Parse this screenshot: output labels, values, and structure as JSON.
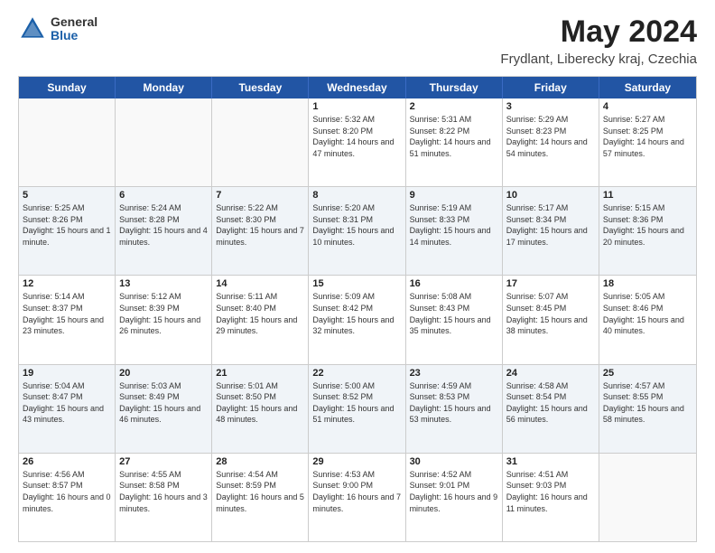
{
  "logo": {
    "general": "General",
    "blue": "Blue"
  },
  "header": {
    "title": "May 2024",
    "subtitle": "Frydlant, Liberecky kraj, Czechia"
  },
  "days": [
    "Sunday",
    "Monday",
    "Tuesday",
    "Wednesday",
    "Thursday",
    "Friday",
    "Saturday"
  ],
  "weeks": [
    [
      {
        "date": "",
        "sunrise": "",
        "sunset": "",
        "daylight": "",
        "empty": true
      },
      {
        "date": "",
        "sunrise": "",
        "sunset": "",
        "daylight": "",
        "empty": true
      },
      {
        "date": "",
        "sunrise": "",
        "sunset": "",
        "daylight": "",
        "empty": true
      },
      {
        "date": "1",
        "sunrise": "Sunrise: 5:32 AM",
        "sunset": "Sunset: 8:20 PM",
        "daylight": "Daylight: 14 hours and 47 minutes."
      },
      {
        "date": "2",
        "sunrise": "Sunrise: 5:31 AM",
        "sunset": "Sunset: 8:22 PM",
        "daylight": "Daylight: 14 hours and 51 minutes."
      },
      {
        "date": "3",
        "sunrise": "Sunrise: 5:29 AM",
        "sunset": "Sunset: 8:23 PM",
        "daylight": "Daylight: 14 hours and 54 minutes."
      },
      {
        "date": "4",
        "sunrise": "Sunrise: 5:27 AM",
        "sunset": "Sunset: 8:25 PM",
        "daylight": "Daylight: 14 hours and 57 minutes."
      }
    ],
    [
      {
        "date": "5",
        "sunrise": "Sunrise: 5:25 AM",
        "sunset": "Sunset: 8:26 PM",
        "daylight": "Daylight: 15 hours and 1 minute."
      },
      {
        "date": "6",
        "sunrise": "Sunrise: 5:24 AM",
        "sunset": "Sunset: 8:28 PM",
        "daylight": "Daylight: 15 hours and 4 minutes."
      },
      {
        "date": "7",
        "sunrise": "Sunrise: 5:22 AM",
        "sunset": "Sunset: 8:30 PM",
        "daylight": "Daylight: 15 hours and 7 minutes."
      },
      {
        "date": "8",
        "sunrise": "Sunrise: 5:20 AM",
        "sunset": "Sunset: 8:31 PM",
        "daylight": "Daylight: 15 hours and 10 minutes."
      },
      {
        "date": "9",
        "sunrise": "Sunrise: 5:19 AM",
        "sunset": "Sunset: 8:33 PM",
        "daylight": "Daylight: 15 hours and 14 minutes."
      },
      {
        "date": "10",
        "sunrise": "Sunrise: 5:17 AM",
        "sunset": "Sunset: 8:34 PM",
        "daylight": "Daylight: 15 hours and 17 minutes."
      },
      {
        "date": "11",
        "sunrise": "Sunrise: 5:15 AM",
        "sunset": "Sunset: 8:36 PM",
        "daylight": "Daylight: 15 hours and 20 minutes."
      }
    ],
    [
      {
        "date": "12",
        "sunrise": "Sunrise: 5:14 AM",
        "sunset": "Sunset: 8:37 PM",
        "daylight": "Daylight: 15 hours and 23 minutes."
      },
      {
        "date": "13",
        "sunrise": "Sunrise: 5:12 AM",
        "sunset": "Sunset: 8:39 PM",
        "daylight": "Daylight: 15 hours and 26 minutes."
      },
      {
        "date": "14",
        "sunrise": "Sunrise: 5:11 AM",
        "sunset": "Sunset: 8:40 PM",
        "daylight": "Daylight: 15 hours and 29 minutes."
      },
      {
        "date": "15",
        "sunrise": "Sunrise: 5:09 AM",
        "sunset": "Sunset: 8:42 PM",
        "daylight": "Daylight: 15 hours and 32 minutes."
      },
      {
        "date": "16",
        "sunrise": "Sunrise: 5:08 AM",
        "sunset": "Sunset: 8:43 PM",
        "daylight": "Daylight: 15 hours and 35 minutes."
      },
      {
        "date": "17",
        "sunrise": "Sunrise: 5:07 AM",
        "sunset": "Sunset: 8:45 PM",
        "daylight": "Daylight: 15 hours and 38 minutes."
      },
      {
        "date": "18",
        "sunrise": "Sunrise: 5:05 AM",
        "sunset": "Sunset: 8:46 PM",
        "daylight": "Daylight: 15 hours and 40 minutes."
      }
    ],
    [
      {
        "date": "19",
        "sunrise": "Sunrise: 5:04 AM",
        "sunset": "Sunset: 8:47 PM",
        "daylight": "Daylight: 15 hours and 43 minutes."
      },
      {
        "date": "20",
        "sunrise": "Sunrise: 5:03 AM",
        "sunset": "Sunset: 8:49 PM",
        "daylight": "Daylight: 15 hours and 46 minutes."
      },
      {
        "date": "21",
        "sunrise": "Sunrise: 5:01 AM",
        "sunset": "Sunset: 8:50 PM",
        "daylight": "Daylight: 15 hours and 48 minutes."
      },
      {
        "date": "22",
        "sunrise": "Sunrise: 5:00 AM",
        "sunset": "Sunset: 8:52 PM",
        "daylight": "Daylight: 15 hours and 51 minutes."
      },
      {
        "date": "23",
        "sunrise": "Sunrise: 4:59 AM",
        "sunset": "Sunset: 8:53 PM",
        "daylight": "Daylight: 15 hours and 53 minutes."
      },
      {
        "date": "24",
        "sunrise": "Sunrise: 4:58 AM",
        "sunset": "Sunset: 8:54 PM",
        "daylight": "Daylight: 15 hours and 56 minutes."
      },
      {
        "date": "25",
        "sunrise": "Sunrise: 4:57 AM",
        "sunset": "Sunset: 8:55 PM",
        "daylight": "Daylight: 15 hours and 58 minutes."
      }
    ],
    [
      {
        "date": "26",
        "sunrise": "Sunrise: 4:56 AM",
        "sunset": "Sunset: 8:57 PM",
        "daylight": "Daylight: 16 hours and 0 minutes."
      },
      {
        "date": "27",
        "sunrise": "Sunrise: 4:55 AM",
        "sunset": "Sunset: 8:58 PM",
        "daylight": "Daylight: 16 hours and 3 minutes."
      },
      {
        "date": "28",
        "sunrise": "Sunrise: 4:54 AM",
        "sunset": "Sunset: 8:59 PM",
        "daylight": "Daylight: 16 hours and 5 minutes."
      },
      {
        "date": "29",
        "sunrise": "Sunrise: 4:53 AM",
        "sunset": "Sunset: 9:00 PM",
        "daylight": "Daylight: 16 hours and 7 minutes."
      },
      {
        "date": "30",
        "sunrise": "Sunrise: 4:52 AM",
        "sunset": "Sunset: 9:01 PM",
        "daylight": "Daylight: 16 hours and 9 minutes."
      },
      {
        "date": "31",
        "sunrise": "Sunrise: 4:51 AM",
        "sunset": "Sunset: 9:03 PM",
        "daylight": "Daylight: 16 hours and 11 minutes."
      },
      {
        "date": "",
        "sunrise": "",
        "sunset": "",
        "daylight": "",
        "empty": true
      }
    ]
  ]
}
